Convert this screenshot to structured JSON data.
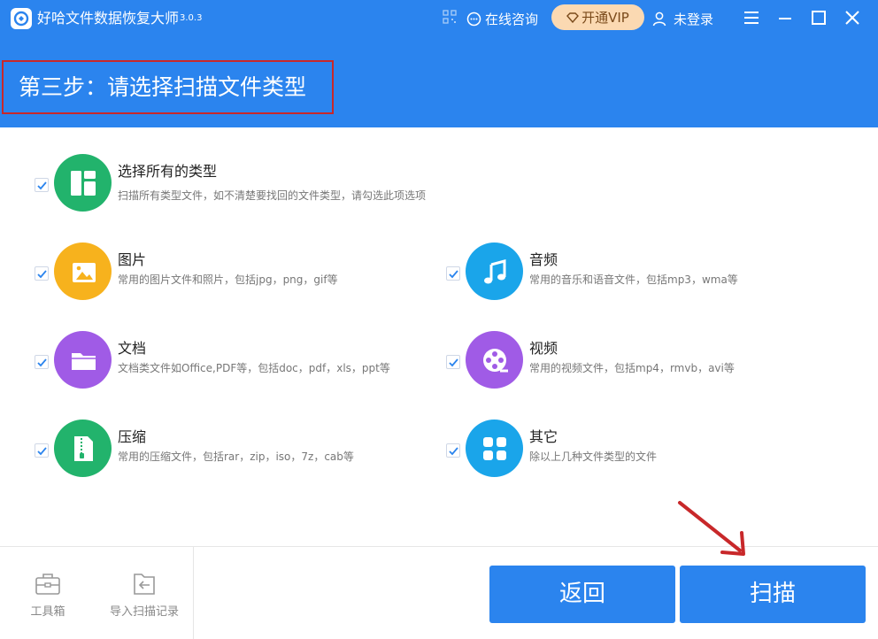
{
  "app": {
    "title": "好哈文件数据恢复大师",
    "version": "3.0.3",
    "consult_label": "在线咨询",
    "vip_label": "开通VIP",
    "user_label": "未登录"
  },
  "step": {
    "title": "第三步：请选择扫描文件类型"
  },
  "select_all": {
    "label": "选择所有的类型",
    "desc": "扫描所有类型文件，如不清楚要找回的文件类型，请勾选此项选项",
    "checked": true
  },
  "categories": [
    {
      "label": "图片",
      "desc": "常用的图片文件和照片，包括jpg，png，gif等",
      "color": "#f7b21d",
      "icon": "image-icon",
      "checked": true
    },
    {
      "label": "音频",
      "desc": "常用的音乐和语音文件，包括mp3，wma等",
      "color": "#1aa5ea",
      "icon": "music-icon",
      "checked": true
    },
    {
      "label": "文档",
      "desc": "文档类文件如Office,PDF等，包括doc，pdf，xls，ppt等",
      "color": "#a05be6",
      "icon": "folder-icon",
      "checked": true
    },
    {
      "label": "视频",
      "desc": "常用的视频文件，包括mp4，rmvb，avi等",
      "color": "#a05be6",
      "icon": "film-reel-icon",
      "checked": true
    },
    {
      "label": "压缩",
      "desc": "常用的压缩文件，包括rar，zip，iso，7z，cab等",
      "color": "#22b36c",
      "icon": "zip-icon",
      "checked": true
    },
    {
      "label": "其它",
      "desc": "除以上几种文件类型的文件",
      "color": "#1aa5ea",
      "icon": "grid-icon",
      "checked": true
    }
  ],
  "select_all_color": "#22b36c",
  "footer": {
    "tools": [
      {
        "label": "工具箱",
        "icon": "toolbox-icon"
      },
      {
        "label": "导入扫描记录",
        "icon": "import-record-icon"
      }
    ],
    "back_label": "返回",
    "scan_label": "扫描"
  },
  "colors": {
    "primary": "#2b84ee",
    "highlight_border": "#c8282a",
    "arrow": "#c8282a",
    "vip_bg": "#fbd9b2"
  }
}
